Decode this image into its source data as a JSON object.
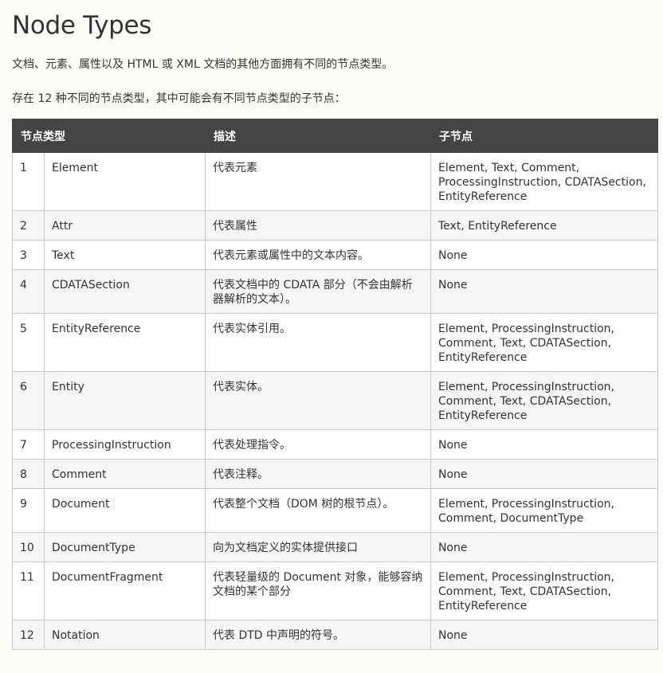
{
  "page": {
    "title": "Node Types",
    "intro_1": "文档、元素、属性以及 HTML 或 XML 文档的其他方面拥有不同的节点类型。",
    "intro_2": "存在 12 种不同的节点类型，其中可能会有不同节点类型的子节点："
  },
  "table": {
    "headers": [
      "节点类型",
      "描述",
      "子节点"
    ],
    "rows": [
      {
        "num": "1",
        "type": "Element",
        "desc": "代表元素",
        "children": "Element, Text, Comment, ProcessingInstruction, CDATASection, EntityReference"
      },
      {
        "num": "2",
        "type": "Attr",
        "desc": "代表属性",
        "children": "Text, EntityReference"
      },
      {
        "num": "3",
        "type": "Text",
        "desc": "代表元素或属性中的文本内容。",
        "children": "None"
      },
      {
        "num": "4",
        "type": "CDATASection",
        "desc": "代表文档中的 CDATA 部分（不会由解析器解析的文本）。",
        "children": "None"
      },
      {
        "num": "5",
        "type": "EntityReference",
        "desc": "代表实体引用。",
        "children": "Element, ProcessingInstruction, Comment, Text, CDATASection, EntityReference"
      },
      {
        "num": "6",
        "type": "Entity",
        "desc": "代表实体。",
        "children": "Element, ProcessingInstruction, Comment, Text, CDATASection, EntityReference"
      },
      {
        "num": "7",
        "type": "ProcessingInstruction",
        "desc": "代表处理指令。",
        "children": "None"
      },
      {
        "num": "8",
        "type": "Comment",
        "desc": "代表注释。",
        "children": "None"
      },
      {
        "num": "9",
        "type": "Document",
        "desc": "代表整个文档（DOM 树的根节点）。",
        "children": "Element, ProcessingInstruction, Comment, DocumentType"
      },
      {
        "num": "10",
        "type": "DocumentType",
        "desc": "向为文档定义的实体提供接口",
        "children": "None"
      },
      {
        "num": "11",
        "type": "DocumentFragment",
        "desc": "代表轻量级的 Document 对象，能够容纳文档的某个部分",
        "children": "Element, ProcessingInstruction, Comment, Text, CDATASection, EntityReference"
      },
      {
        "num": "12",
        "type": "Notation",
        "desc": "代表 DTD 中声明的符号。",
        "children": "None"
      }
    ]
  }
}
